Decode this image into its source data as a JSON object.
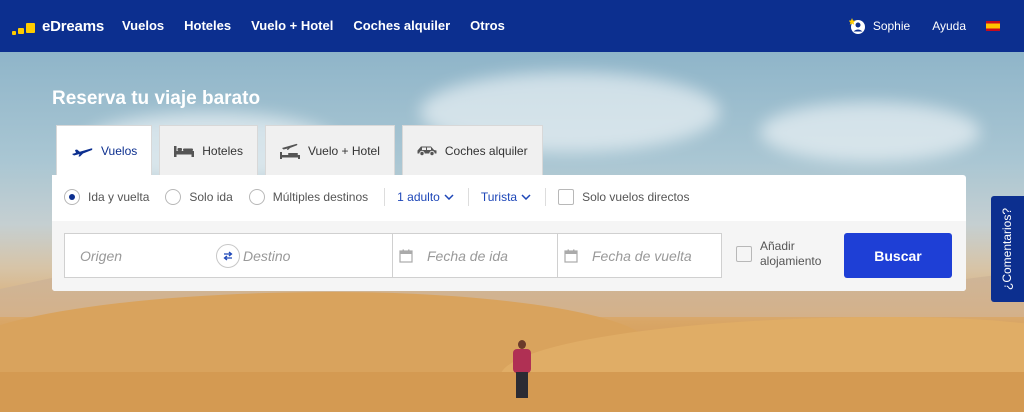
{
  "header": {
    "logo_text": "eDreams",
    "nav": [
      "Vuelos",
      "Hoteles",
      "Vuelo + Hotel",
      "Coches alquiler",
      "Otros"
    ],
    "user_name": "Sophie",
    "help": "Ayuda"
  },
  "hero": {
    "title": "Reserva tu viaje barato"
  },
  "tabs": [
    {
      "label": "Vuelos",
      "icon": "plane-icon",
      "active": true
    },
    {
      "label": "Hoteles",
      "icon": "bed-icon"
    },
    {
      "label": "Vuelo + Hotel",
      "icon": "plane-hotel-icon"
    },
    {
      "label": "Coches alquiler",
      "icon": "car-icon"
    }
  ],
  "options": {
    "round_trip": "Ida y vuelta",
    "one_way": "Solo ida",
    "multi": "Múltiples destinos",
    "passengers": "1 adulto",
    "cabin": "Turista",
    "direct": "Solo vuelos directos"
  },
  "fields": {
    "origin_placeholder": "Origen",
    "destination_placeholder": "Destino",
    "depart_placeholder": "Fecha de ida",
    "return_placeholder": "Fecha de vuelta",
    "add_hotel_line1": "Añadir",
    "add_hotel_line2": "alojamiento",
    "search_button": "Buscar"
  },
  "feedback": "¿Comentarios?",
  "colors": {
    "brand": "#0c2f8f",
    "accent": "#ffcc00",
    "button": "#1e3fd6",
    "link": "#1e47b8"
  }
}
